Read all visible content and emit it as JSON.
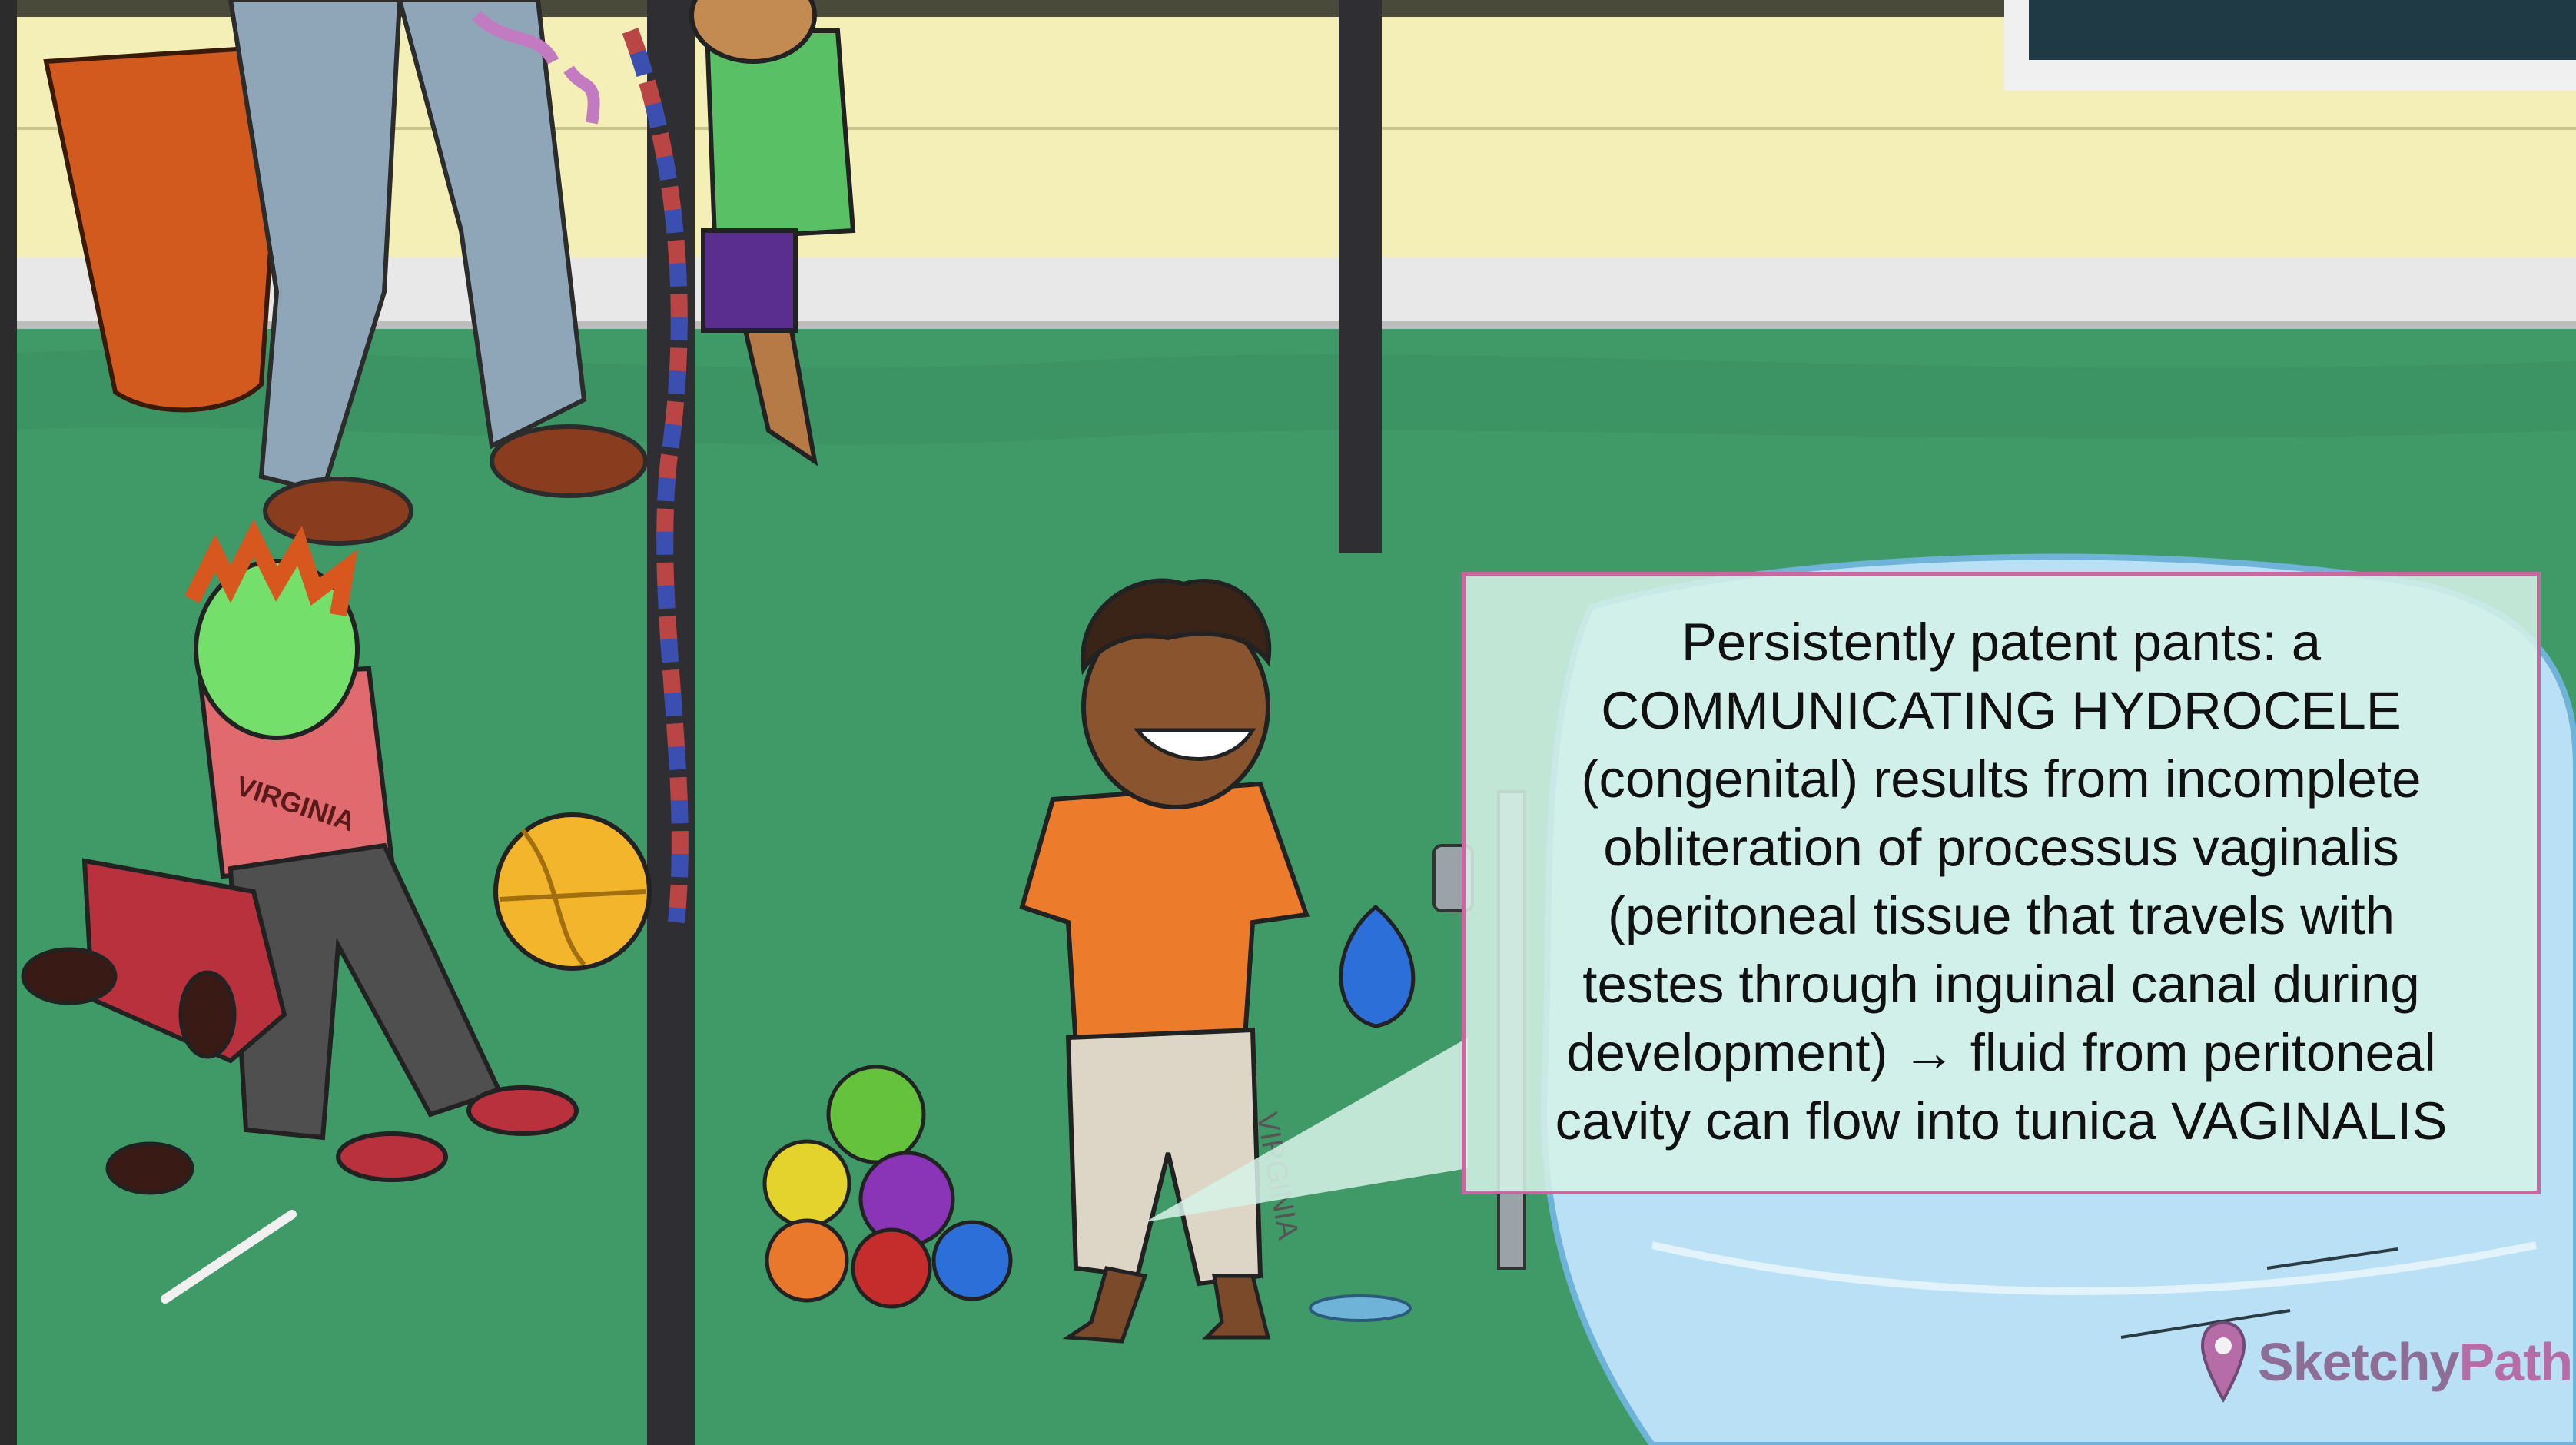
{
  "callout": {
    "lines": [
      "Persistently patent pants: a",
      "COMMUNICATING HYDROCELE",
      "(congenital) results from incomplete",
      "obliteration of processus vaginalis",
      "(peritoneal tissue that travels with",
      "testes through inguinal canal during",
      "development) → fluid from peritoneal",
      "cavity can flow into tunica VAGINALIS"
    ]
  },
  "scene": {
    "shirt_text_left": "VIRGINIA",
    "pants_text_center": "VIRGINIA"
  },
  "brand": {
    "part1": "Sketchy",
    "part2": "Path",
    "icon": "sketchy-path-logo-icon"
  },
  "colors": {
    "grass": "#3f9a68",
    "wall": "#f3efb6",
    "pool": "#b9e0f5",
    "callout_border": "#c9679f",
    "brand_dark": "#8c6e96",
    "brand_light": "#b66ca7"
  }
}
